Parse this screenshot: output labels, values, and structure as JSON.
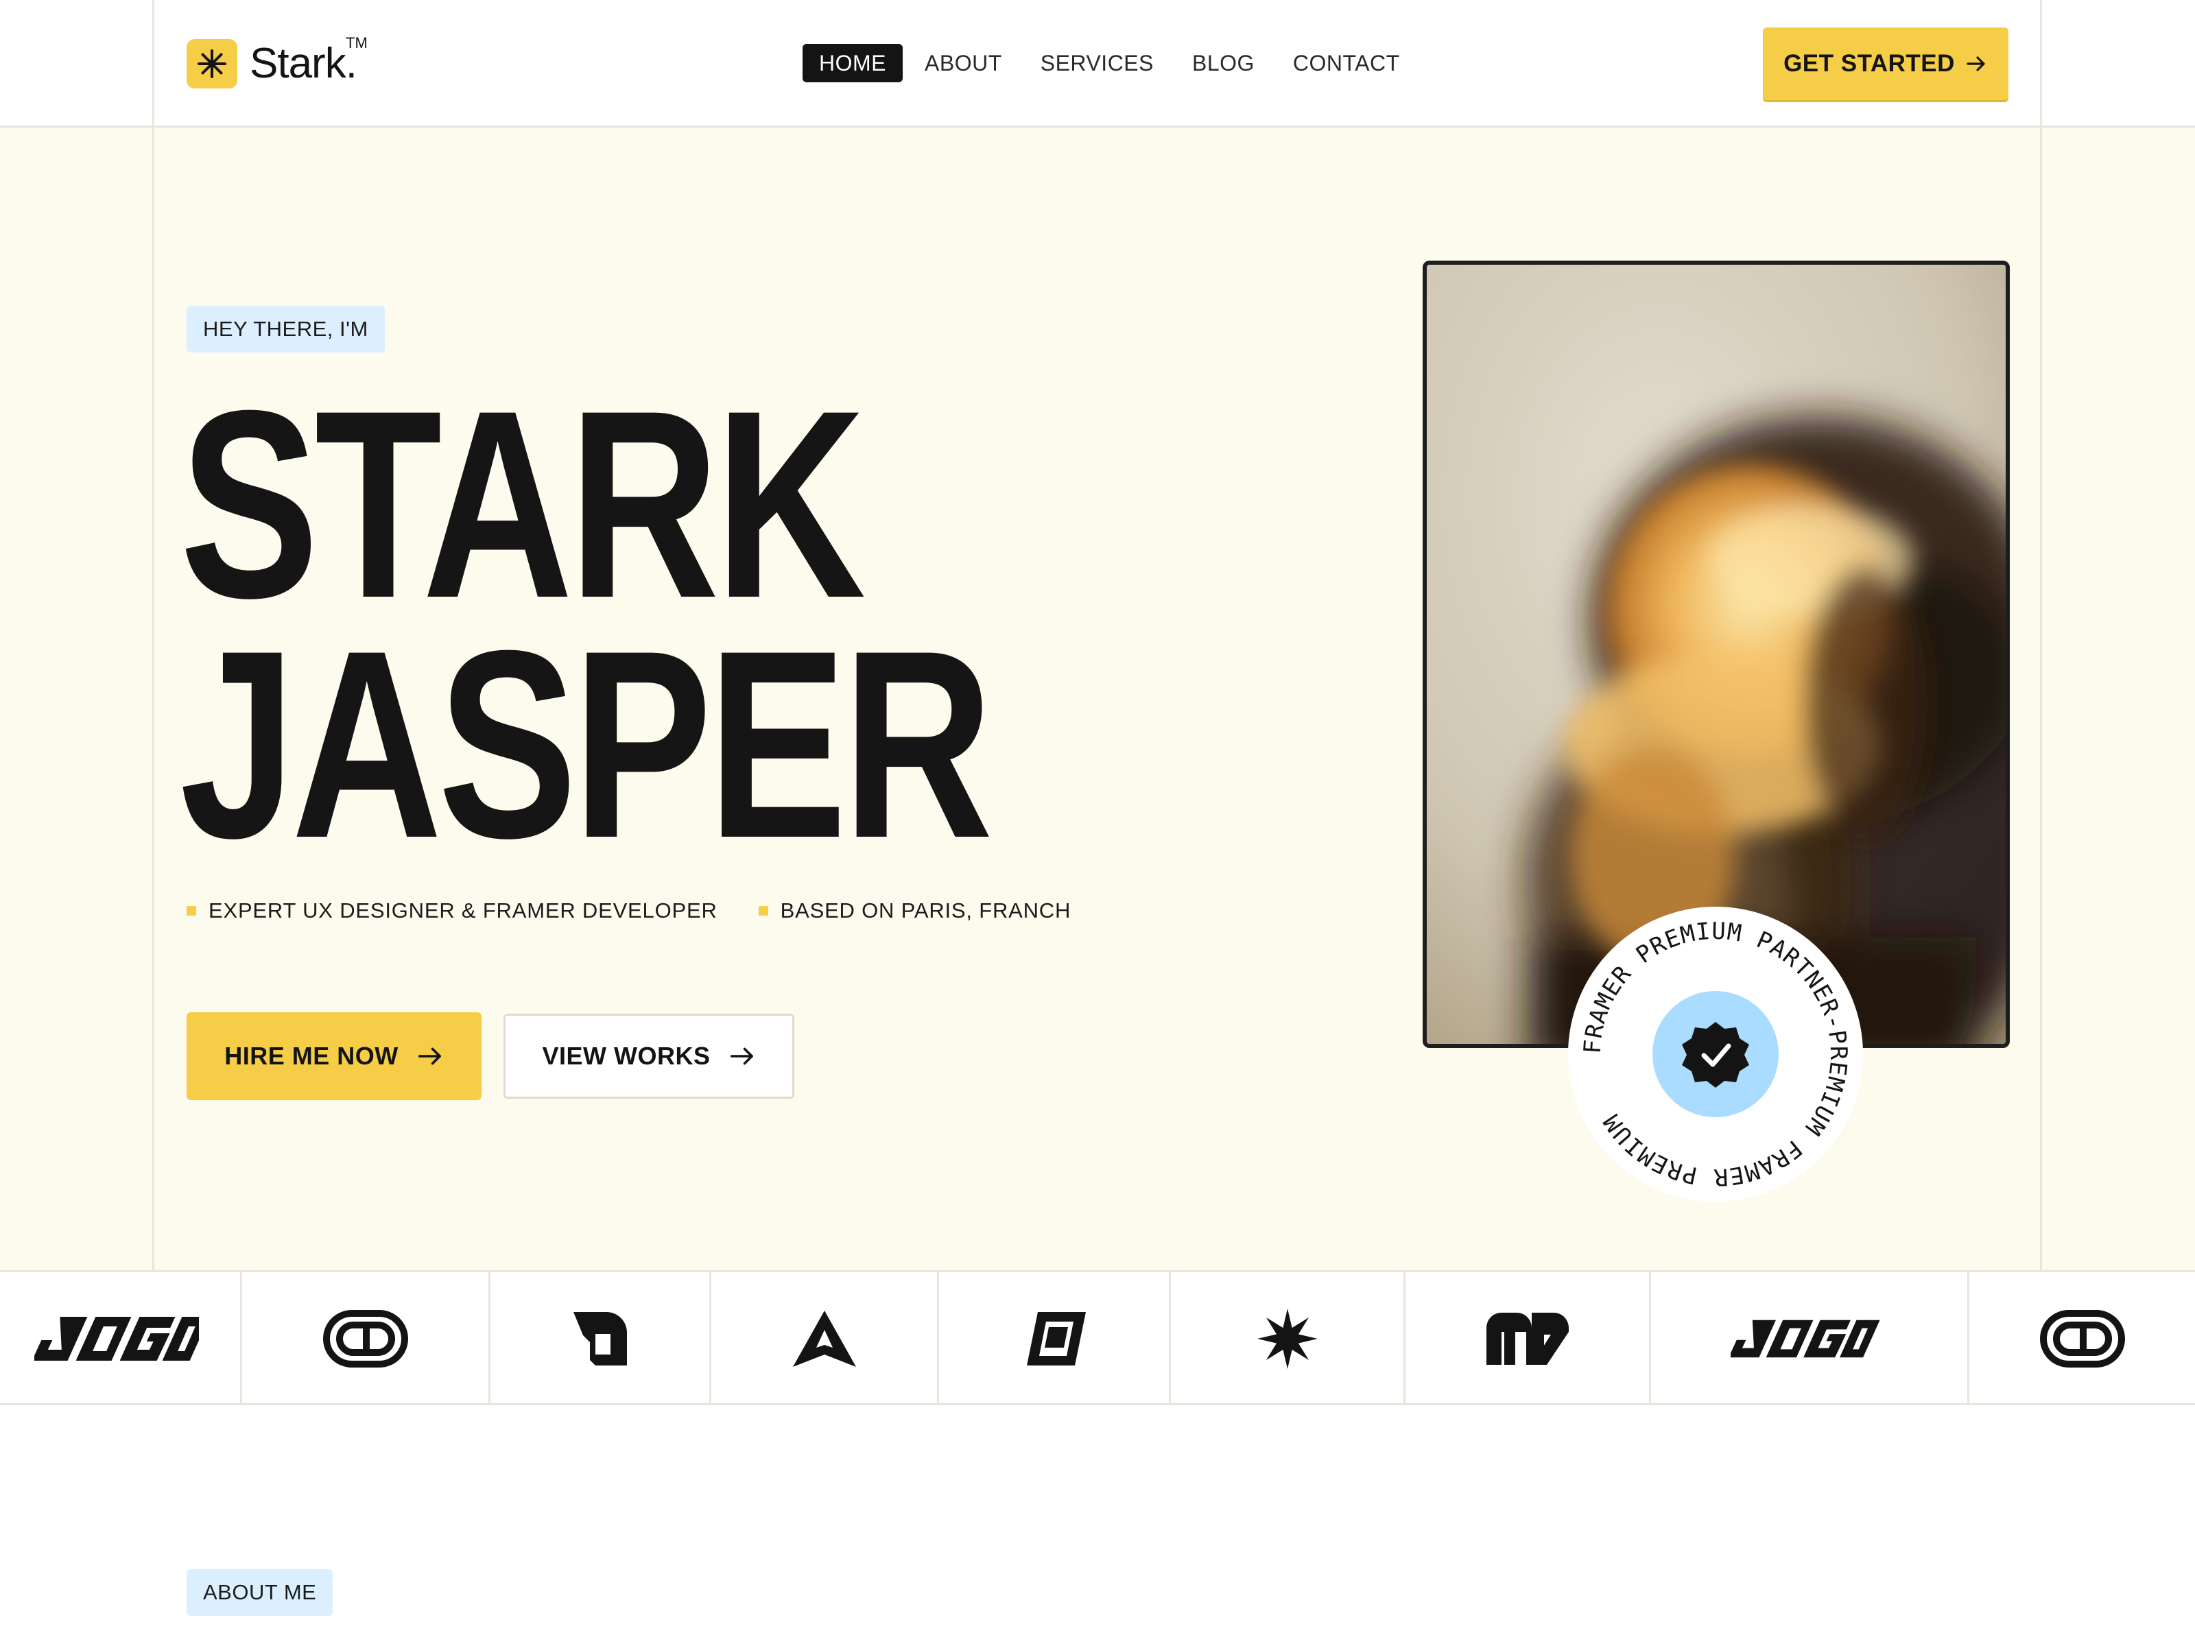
{
  "brand": {
    "name": "Stark.",
    "trademark": "TM",
    "accent_color": "#f6cd47",
    "icon": "asterisk-icon"
  },
  "nav": {
    "items": [
      {
        "label": "HOME",
        "active": true
      },
      {
        "label": "ABOUT",
        "active": false
      },
      {
        "label": "SERVICES",
        "active": false
      },
      {
        "label": "BLOG",
        "active": false
      },
      {
        "label": "CONTACT",
        "active": false
      }
    ],
    "cta_label": "GET STARTED",
    "cta_icon": "arrow-right-icon"
  },
  "hero": {
    "greeting": "HEY THERE, I'M",
    "name_line1": "STARK",
    "name_line2": "JASPER",
    "bullets": [
      "EXPERT UX DESIGNER & FRAMER DEVELOPER",
      "BASED ON PARIS, FRANCH"
    ],
    "primary_button": "HIRE ME NOW",
    "secondary_button": "VIEW WORKS",
    "photo": "portrait-photo",
    "badge_text": "FRAMER PREMIUM PARTNER-PREMIUM FRAMER PREMIUM",
    "badge_icon": "verified-check-icon",
    "badge_color": "#a9dcff"
  },
  "partner_logos": [
    "logo-wordmark-icon",
    "logo-pill-icon",
    "logo-d-icon",
    "logo-a-icon",
    "logo-cube-icon",
    "logo-star-icon",
    "logo-m-icon",
    "logo-wordmark-icon",
    "logo-pill-icon"
  ],
  "about": {
    "tag": "ABOUT ME"
  }
}
